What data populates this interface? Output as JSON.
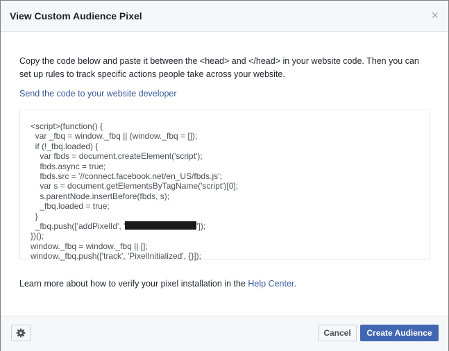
{
  "dialog": {
    "title": "View Custom Audience Pixel",
    "close_icon": "×",
    "description": "Copy the code below and paste it between the <head> and </head> in your website code. Then you can set up rules to track specific actions people take across your website.",
    "send_link": "Send the code to your website developer"
  },
  "code": {
    "lines": [
      "<script>(function() {",
      "  var _fbq = window._fbq || (window._fbq = []);",
      "  if (!_fbq.loaded) {",
      "    var fbds = document.createElement('script');",
      "    fbds.async = true;",
      "    fbds.src = '//connect.facebook.net/en_US/fbds.js';",
      "    var s = document.getElementsByTagName('script')[0];",
      "    s.parentNode.insertBefore(fbds, s);",
      "    _fbq.loaded = true;",
      "  }"
    ],
    "push_prefix": "  _fbq.push(['addPixelId', '",
    "push_suffix": "']);",
    "lines_after": [
      "})();",
      "window._fbq = window._fbq || [];",
      "window._fbq.push(['track', 'PixelInitialized', {}]);"
    ]
  },
  "learn": {
    "text": "Learn more about how to verify your pixel installation in the ",
    "link": "Help Center",
    "end": "."
  },
  "footer": {
    "gear_icon": "gear-icon",
    "cancel_label": "Cancel",
    "create_label": "Create Audience"
  },
  "colors": {
    "link": "#365899",
    "primary_button": "#4267b2",
    "header_bg": "#f6f7f9"
  }
}
